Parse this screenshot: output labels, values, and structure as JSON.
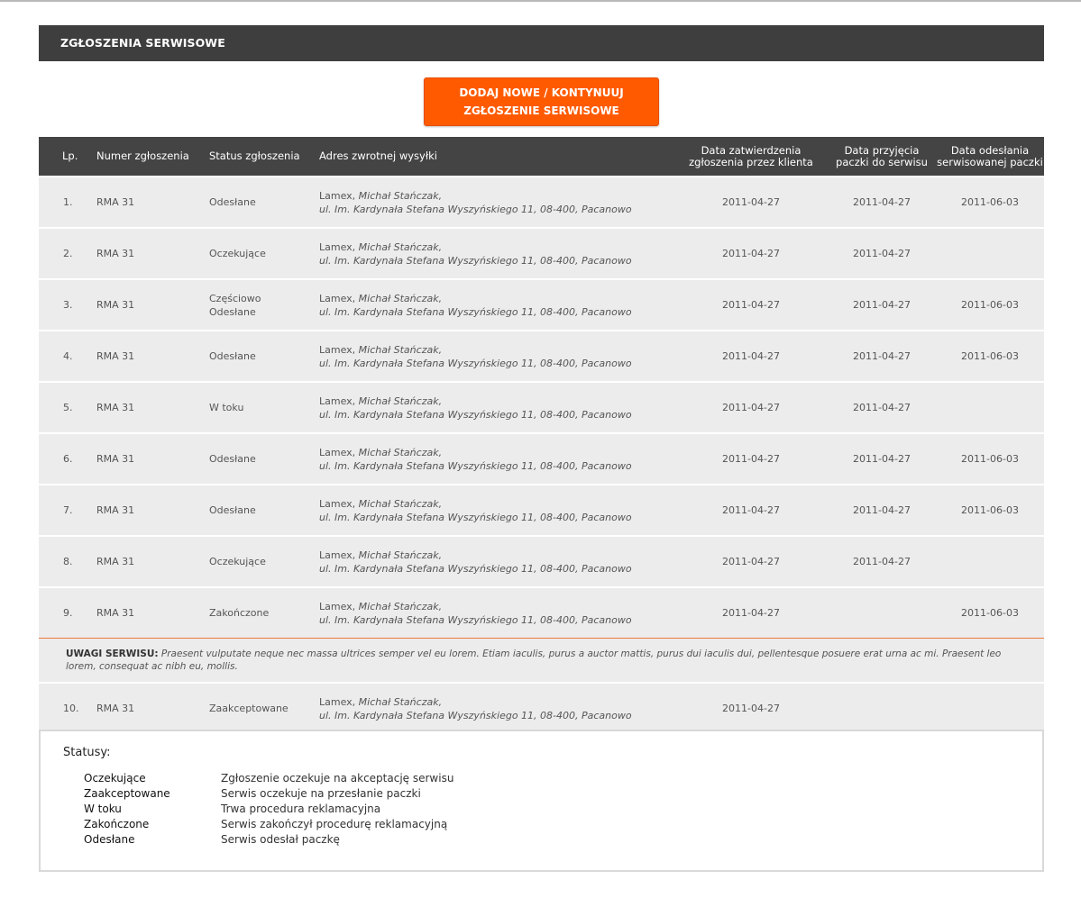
{
  "header": {
    "title": "ZGŁOSZENIA SERWISOWE"
  },
  "add_button": {
    "line1": "DODAJ NOWE / KONTYNUUJ",
    "line2": "ZGŁOSZENIE SERWISOWE"
  },
  "colors": {
    "accent": "#ff5a00",
    "header_bg": "#3e3e3e",
    "row_bg": "#ececec"
  },
  "table": {
    "columns": {
      "lp": "Lp.",
      "number": "Numer zgłoszenia",
      "status": "Status zgłoszenia",
      "address": "Adres zwrotnej wysyłki",
      "approved_1": "Data zatwierdzenia",
      "approved_2": "zgłoszenia przez klienta",
      "received_1": "Data przyjęcia",
      "received_2": "paczki do serwisu",
      "sent_1": "Data odesłania",
      "sent_2": "serwisowanej paczki"
    },
    "rows": [
      {
        "lp": "1.",
        "number": "RMA 31",
        "status": "Odesłane",
        "status2": "",
        "company": "Lamex,",
        "person": "Michał Stańczak,",
        "street": "ul. Im. Kardynała Stefana Wyszyńskiego 11, 08-400, Pacanowo",
        "approved": "2011-04-27",
        "received": "2011-04-27",
        "sent": "2011-06-03"
      },
      {
        "lp": "2.",
        "number": "RMA 31",
        "status": "Oczekujące",
        "status2": "",
        "company": "Lamex,",
        "person": "Michał Stańczak,",
        "street": "ul. Im. Kardynała Stefana Wyszyńskiego 11, 08-400, Pacanowo",
        "approved": "2011-04-27",
        "received": "2011-04-27",
        "sent": ""
      },
      {
        "lp": "3.",
        "number": "RMA 31",
        "status": "Częściowo",
        "status2": "Odesłane",
        "company": "Lamex,",
        "person": "Michał Stańczak,",
        "street": "ul. Im. Kardynała Stefana Wyszyńskiego 11, 08-400, Pacanowo",
        "approved": "2011-04-27",
        "received": "2011-04-27",
        "sent": "2011-06-03"
      },
      {
        "lp": "4.",
        "number": "RMA 31",
        "status": "Odesłane",
        "status2": "",
        "company": "Lamex,",
        "person": "Michał Stańczak,",
        "street": "ul. Im. Kardynała Stefana Wyszyńskiego 11, 08-400, Pacanowo",
        "approved": "2011-04-27",
        "received": "2011-04-27",
        "sent": "2011-06-03"
      },
      {
        "lp": "5.",
        "number": "RMA 31",
        "status": "W toku",
        "status2": "",
        "company": "Lamex,",
        "person": "Michał Stańczak,",
        "street": "ul. Im. Kardynała Stefana Wyszyńskiego 11, 08-400, Pacanowo",
        "approved": "2011-04-27",
        "received": "2011-04-27",
        "sent": ""
      },
      {
        "lp": "6.",
        "number": "RMA 31",
        "status": "Odesłane",
        "status2": "",
        "company": "Lamex,",
        "person": "Michał Stańczak,",
        "street": "ul. Im. Kardynała Stefana Wyszyńskiego 11, 08-400, Pacanowo",
        "approved": "2011-04-27",
        "received": "2011-04-27",
        "sent": "2011-06-03"
      },
      {
        "lp": "7.",
        "number": "RMA 31",
        "status": "Odesłane",
        "status2": "",
        "company": "Lamex,",
        "person": "Michał Stańczak,",
        "street": "ul. Im. Kardynała Stefana Wyszyńskiego 11, 08-400, Pacanowo",
        "approved": "2011-04-27",
        "received": "2011-04-27",
        "sent": "2011-06-03"
      },
      {
        "lp": "8.",
        "number": "RMA 31",
        "status": "Oczekujące",
        "status2": "",
        "company": "Lamex,",
        "person": "Michał Stańczak,",
        "street": "ul. Im. Kardynała Stefana Wyszyńskiego 11, 08-400, Pacanowo",
        "approved": "2011-04-27",
        "received": "2011-04-27",
        "sent": ""
      },
      {
        "lp": "9.",
        "number": "RMA 31",
        "status": "Zakończone",
        "status2": "",
        "company": "Lamex,",
        "person": "Michał Stańczak,",
        "street": "ul. Im. Kardynała Stefana Wyszyńskiego 11, 08-400, Pacanowo",
        "approved": "2011-04-27",
        "received": "",
        "sent": "2011-06-03",
        "note_label": "UWAGI SERWISU:",
        "note": "Praesent vulputate neque nec massa ultrices semper vel eu lorem. Etiam iaculis, purus a auctor mattis, purus dui iaculis dui, pellentesque posuere erat urna ac mi. Praesent leo lorem, consequat ac nibh eu, mollis."
      },
      {
        "lp": "10.",
        "number": "RMA 31",
        "status": "Zaakceptowane",
        "status2": "",
        "company": "Lamex,",
        "person": "Michał Stańczak,",
        "street": "ul. Im. Kardynała Stefana Wyszyńskiego 11, 08-400, Pacanowo",
        "approved": "2011-04-27",
        "received": "",
        "sent": ""
      }
    ]
  },
  "legend": {
    "title": "Statusy:",
    "items": [
      {
        "name": "Oczekujące",
        "desc": "Zgłoszenie oczekuje na akceptację serwisu"
      },
      {
        "name": "Zaakceptowane",
        "desc": "Serwis oczekuje na przesłanie paczki"
      },
      {
        "name": "W toku",
        "desc": "Trwa procedura reklamacyjna"
      },
      {
        "name": "Zakończone",
        "desc": "Serwis zakończył procedurę reklamacyjną"
      },
      {
        "name": "Odesłane",
        "desc": "Serwis odesłał paczkę"
      }
    ]
  }
}
